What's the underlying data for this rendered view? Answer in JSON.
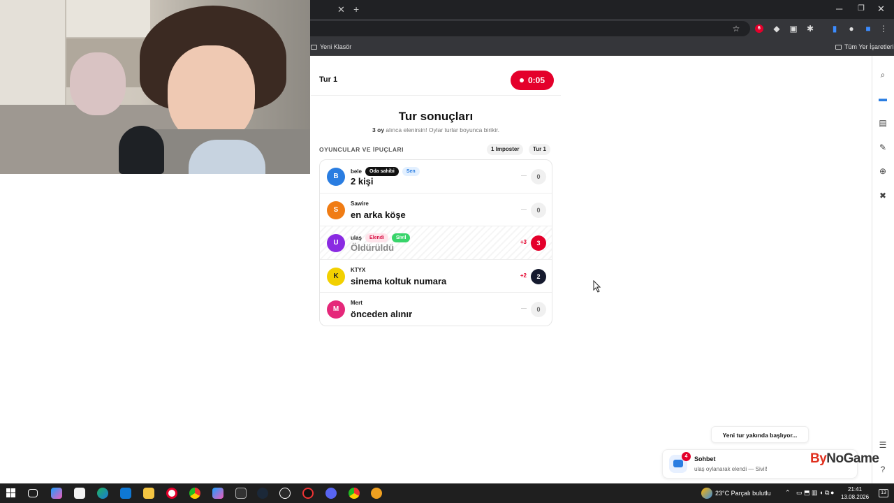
{
  "browser": {
    "bookmarks": [
      "Yeni Klasör"
    ],
    "all_bookmarks_label": "Tüm Yer İşaretleri",
    "extension_badge": "6"
  },
  "game": {
    "turn_label": "Tur 1",
    "timer": "0:05",
    "results_title": "Tur sonuçları",
    "results_sub_bold": "3 oy",
    "results_sub_rest": " alınca elenirsin! Oylar turlar boyunca birikir.",
    "section_title": "OYUNCULAR VE İPUÇLARI",
    "pill_imposter": "1 Imposter",
    "pill_turn": "Tur 1",
    "players": [
      {
        "initial": "B",
        "name": "bele",
        "badges": [
          "Oda sahibi",
          "Sen"
        ],
        "hint": "2 kişi",
        "delta": "—",
        "votes": "0",
        "color": "#2a7de1",
        "eliminated": false
      },
      {
        "initial": "S",
        "name": "Sawire",
        "badges": [],
        "hint": "en arka köşe",
        "delta": "—",
        "votes": "0",
        "color": "#f07c14",
        "eliminated": false
      },
      {
        "initial": "U",
        "name": "ulaş",
        "badges": [
          "Elendi",
          "Sivil"
        ],
        "hint": "Öldürüldü",
        "delta": "+3",
        "votes": "3",
        "color": "#8a2be2",
        "eliminated": true
      },
      {
        "initial": "K",
        "name": "KTYX",
        "badges": [],
        "hint": "sinema koltuk numara",
        "delta": "+2",
        "votes": "2",
        "color": "#f2d000",
        "eliminated": false
      },
      {
        "initial": "M",
        "name": "Mert",
        "badges": [],
        "hint": "önceden alınır",
        "delta": "—",
        "votes": "0",
        "color": "#e5287a",
        "eliminated": false
      }
    ]
  },
  "toasts": {
    "next_round": "Yeni tur yakında başlıyor...",
    "chat_title": "Sohbet",
    "chat_message": "ulaş oylanarak elendi — Sivil!",
    "chat_badge": "4"
  },
  "brand": {
    "part1": "By",
    "part2": "NoGame"
  },
  "taskbar": {
    "weather": "23°C  Parçalı bulutlu",
    "time": "21:41",
    "date": "13.08.2026",
    "notifications": "13"
  }
}
